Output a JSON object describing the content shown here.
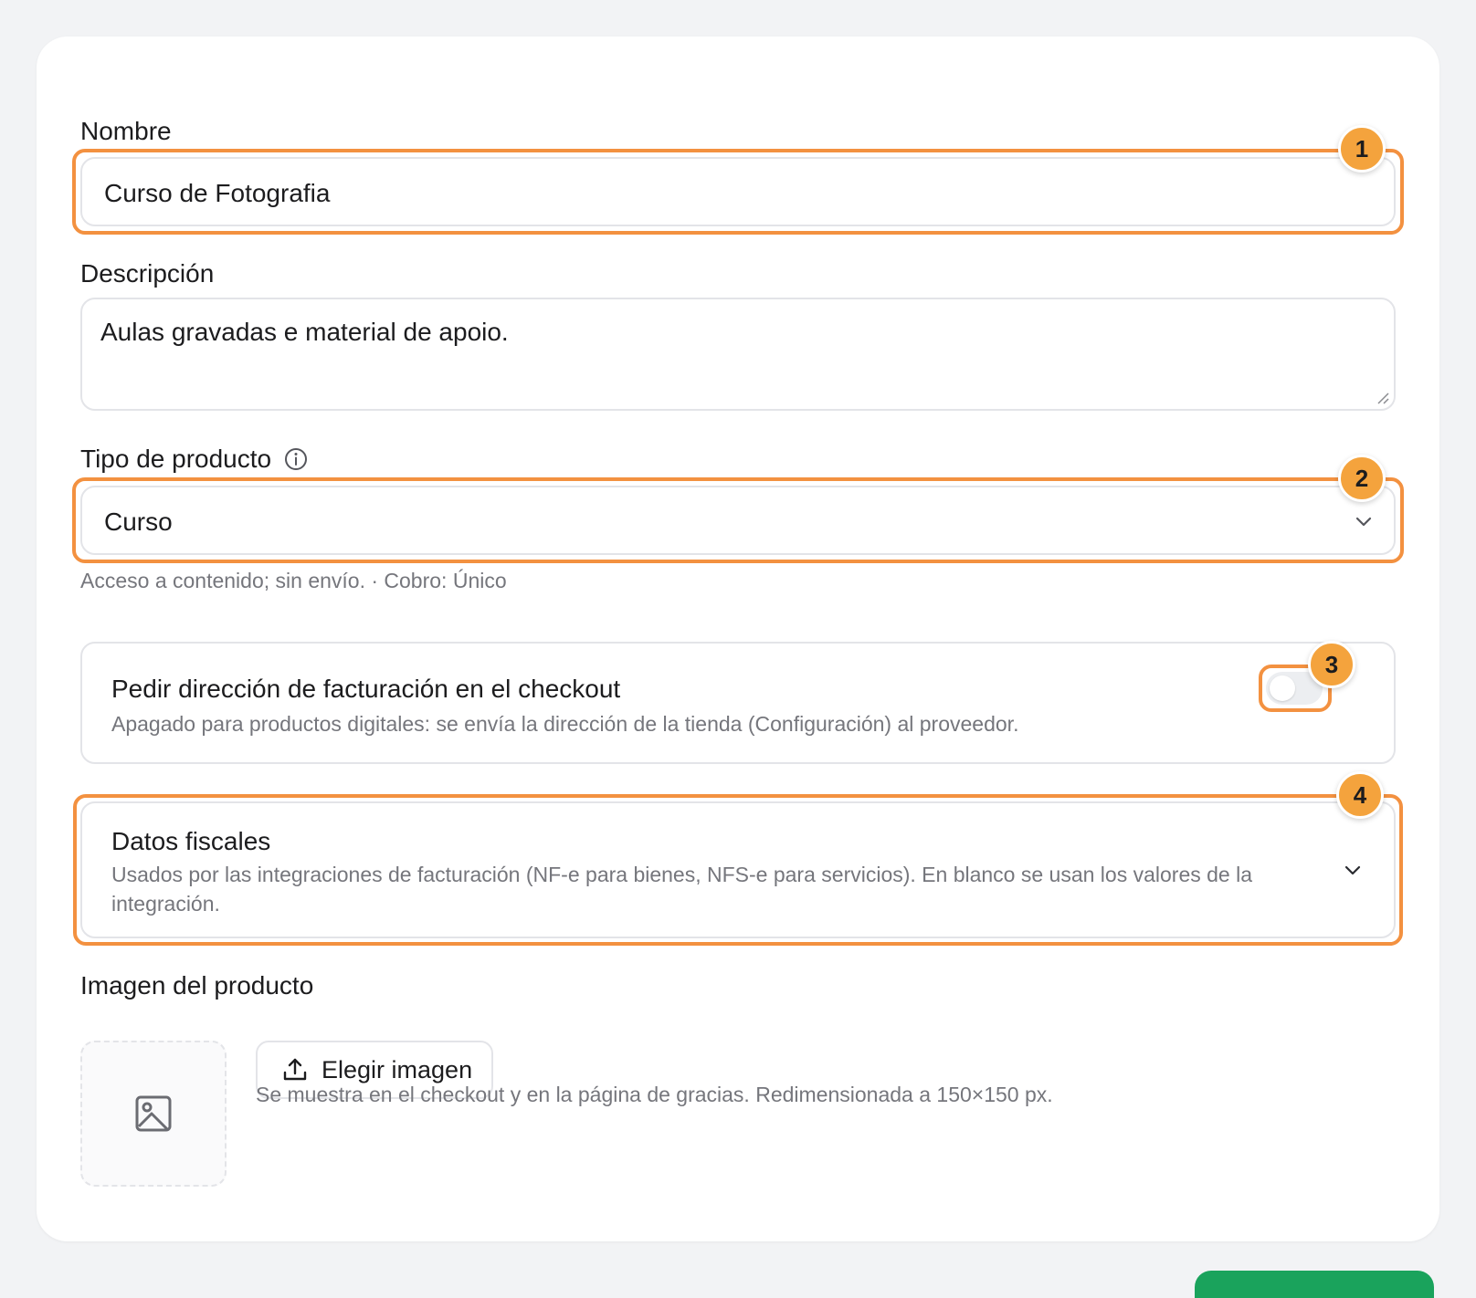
{
  "form": {
    "name": {
      "label": "Nombre",
      "value": "Curso de Fotografia"
    },
    "description": {
      "label": "Descripción",
      "value": "Aulas gravadas e material de apoio."
    },
    "product_type": {
      "label": "Tipo de producto",
      "value": "Curso",
      "hint": "Acceso a contenido; sin envío. · Cobro: Único"
    },
    "billing_address": {
      "title": "Pedir dirección de facturación en el checkout",
      "description": "Apagado para productos digitales: se envía la dirección de la tienda (Configuración) al proveedor.",
      "enabled": false
    },
    "tax_data": {
      "title": "Datos fiscales",
      "description": "Usados por las integraciones de facturación (NF-e para bienes, NFS-e para servicios). En blanco se usan los valores de la integración."
    },
    "image": {
      "label": "Imagen del producto",
      "button_label": "Elegir imagen",
      "hint": "Se muestra en el checkout y en la página de gracias. Redimensionada a 150×150 px."
    }
  },
  "annotations": [
    "1",
    "2",
    "3",
    "4"
  ],
  "icons": {
    "info": "info-icon",
    "chevron": "chevron-down-icon",
    "upload": "upload-icon",
    "image": "image-icon",
    "resize": "resize-handle-icon"
  },
  "colors": {
    "highlight": "#f39140",
    "badge": "#f4a33d",
    "primary": "#1aa35c"
  }
}
